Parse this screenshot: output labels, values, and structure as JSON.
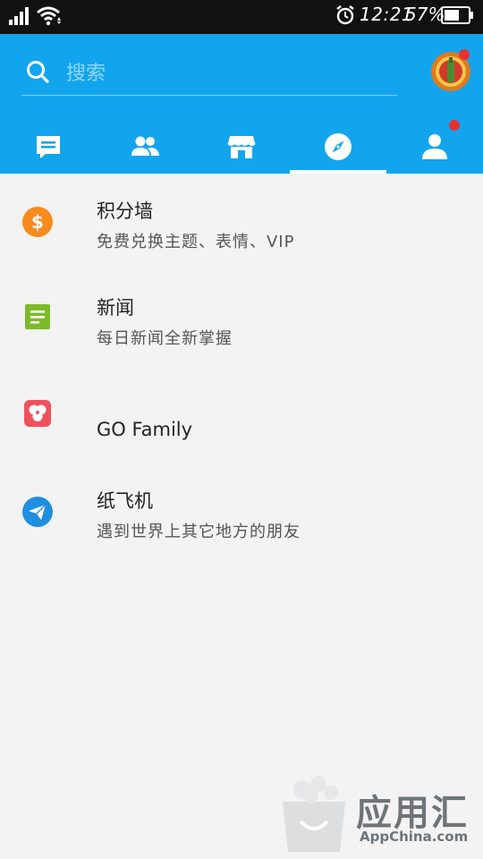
{
  "status_bar": {
    "time": "12:21",
    "battery_percent": "57%",
    "icons": [
      "signal-icon",
      "wifi-icon",
      "alarm-icon",
      "battery-icon"
    ]
  },
  "header": {
    "search": {
      "placeholder": "搜索",
      "value": ""
    },
    "avatar_badge": true,
    "tabs": [
      {
        "icon": "message-icon",
        "active": false,
        "badge": false
      },
      {
        "icon": "contacts-icon",
        "active": false,
        "badge": false
      },
      {
        "icon": "store-icon",
        "active": false,
        "badge": false
      },
      {
        "icon": "compass-icon",
        "active": true,
        "badge": false
      },
      {
        "icon": "profile-icon",
        "active": false,
        "badge": true
      }
    ]
  },
  "list": [
    {
      "icon": "dollar-coin-icon",
      "title": "积分墙",
      "subtitle": "免费兑换主题、表情、VIP",
      "color": "#f98a1e"
    },
    {
      "icon": "news-icon",
      "title": "新闻",
      "subtitle": "每日新闻全新掌握",
      "color": "#7cbb2a"
    },
    {
      "icon": "go-family-icon",
      "title": "GO Family",
      "subtitle": "",
      "color": "#f0505a"
    },
    {
      "icon": "paper-plane-icon",
      "title": "纸飞机",
      "subtitle": "遇到世界上其它地方的朋友",
      "color": "#1f8fe0"
    }
  ],
  "watermark": {
    "cn": "应用汇",
    "en": "AppChina.com"
  },
  "colors": {
    "header": "#12a5ee",
    "badge": "#e8312f",
    "background": "#f3f3f3"
  }
}
